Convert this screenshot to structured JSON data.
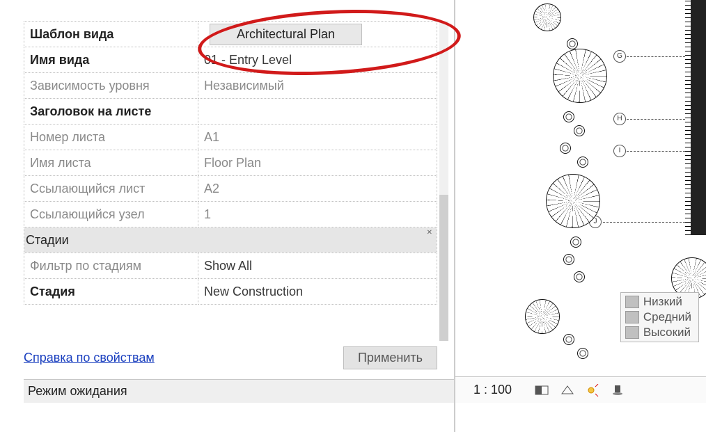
{
  "properties": {
    "rows": [
      {
        "label": "Шаблон вида",
        "value": "Architectural Plan",
        "labelClass": "bold",
        "valType": "button"
      },
      {
        "label": "Имя вида",
        "value": "01 - Entry Level",
        "labelClass": "bold"
      },
      {
        "label": "Зависимость уровня",
        "value": "Независимый",
        "labelClass": "gray",
        "valClass": "gray"
      },
      {
        "label": "Заголовок на листе",
        "value": "",
        "labelClass": "bold"
      },
      {
        "label": "Номер листа",
        "value": "A1",
        "labelClass": "gray",
        "valClass": "gray"
      },
      {
        "label": "Имя листа",
        "value": "Floor Plan",
        "labelClass": "gray",
        "valClass": "gray"
      },
      {
        "label": "Ссылающийся лист",
        "value": "A2",
        "labelClass": "gray",
        "valClass": "gray"
      },
      {
        "label": "Ссылающийся узел",
        "value": "1",
        "labelClass": "gray",
        "valClass": "gray"
      }
    ],
    "group_header": "Стадии",
    "rows2": [
      {
        "label": "Фильтр по стадиям",
        "value": "Show All",
        "labelClass": "gray"
      },
      {
        "label": "Стадия",
        "value": "New Construction",
        "labelClass": "bold"
      }
    ]
  },
  "footer": {
    "help_link": "Справка по свойствам",
    "apply": "Применить"
  },
  "status": {
    "text": "Режим ожидания"
  },
  "grid_bubbles": [
    "G",
    "H",
    "I",
    "J"
  ],
  "detail_menu": {
    "items": [
      "Низкий",
      "Средний",
      "Высокий"
    ]
  },
  "viewbar": {
    "scale": "1 : 100"
  }
}
